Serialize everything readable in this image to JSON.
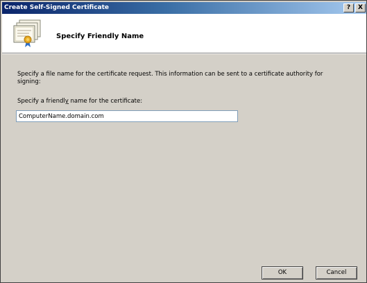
{
  "window": {
    "title": "Create Self-Signed Certificate",
    "help_label": "?",
    "close_label": "X"
  },
  "header": {
    "title": "Specify Friendly Name",
    "icon": "certificate-icon"
  },
  "body": {
    "description": "Specify a file name for the certificate request.  This information can be sent to a certificate authority for signing:",
    "label_prefix": "Specify a friendl",
    "label_accel": "y",
    "label_suffix": " name for the certificate:",
    "input_value": "ComputerName.domain.com"
  },
  "buttons": {
    "ok": "OK",
    "cancel": "Cancel"
  },
  "colors": {
    "titlebar_start": "#0a246a",
    "titlebar_end": "#a6caf0",
    "dialog_bg": "#d4d0c8"
  }
}
